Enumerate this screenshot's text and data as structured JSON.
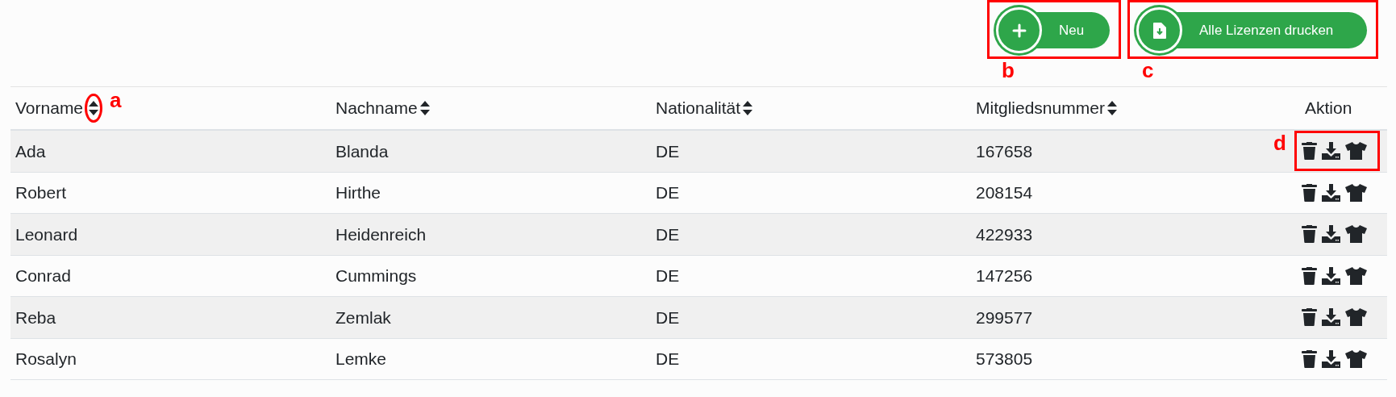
{
  "toolbar": {
    "buttons": [
      {
        "label": "Neu",
        "kind": "add",
        "marker": "b"
      },
      {
        "label": "Alle Lizenzen drucken",
        "kind": "print",
        "marker": "c"
      }
    ]
  },
  "table": {
    "columns": [
      {
        "label": "Vorname",
        "sortable": true,
        "marker": "a"
      },
      {
        "label": "Nachname",
        "sortable": true
      },
      {
        "label": "Nationalität",
        "sortable": true
      },
      {
        "label": "Mitgliedsnummer",
        "sortable": true
      },
      {
        "label": "Aktion",
        "sortable": false
      }
    ],
    "rows": [
      {
        "cells": [
          "Ada",
          "Blanda",
          "DE",
          "167658"
        ],
        "marker": "d"
      },
      {
        "cells": [
          "Robert",
          "Hirthe",
          "DE",
          "208154"
        ]
      },
      {
        "cells": [
          "Leonard",
          "Heidenreich",
          "DE",
          "422933"
        ]
      },
      {
        "cells": [
          "Conrad",
          "Cummings",
          "DE",
          "147256"
        ]
      },
      {
        "cells": [
          "Reba",
          "Zemlak",
          "DE",
          "299577"
        ]
      },
      {
        "cells": [
          "Rosalyn",
          "Lemke",
          "DE",
          "573805"
        ]
      }
    ]
  }
}
